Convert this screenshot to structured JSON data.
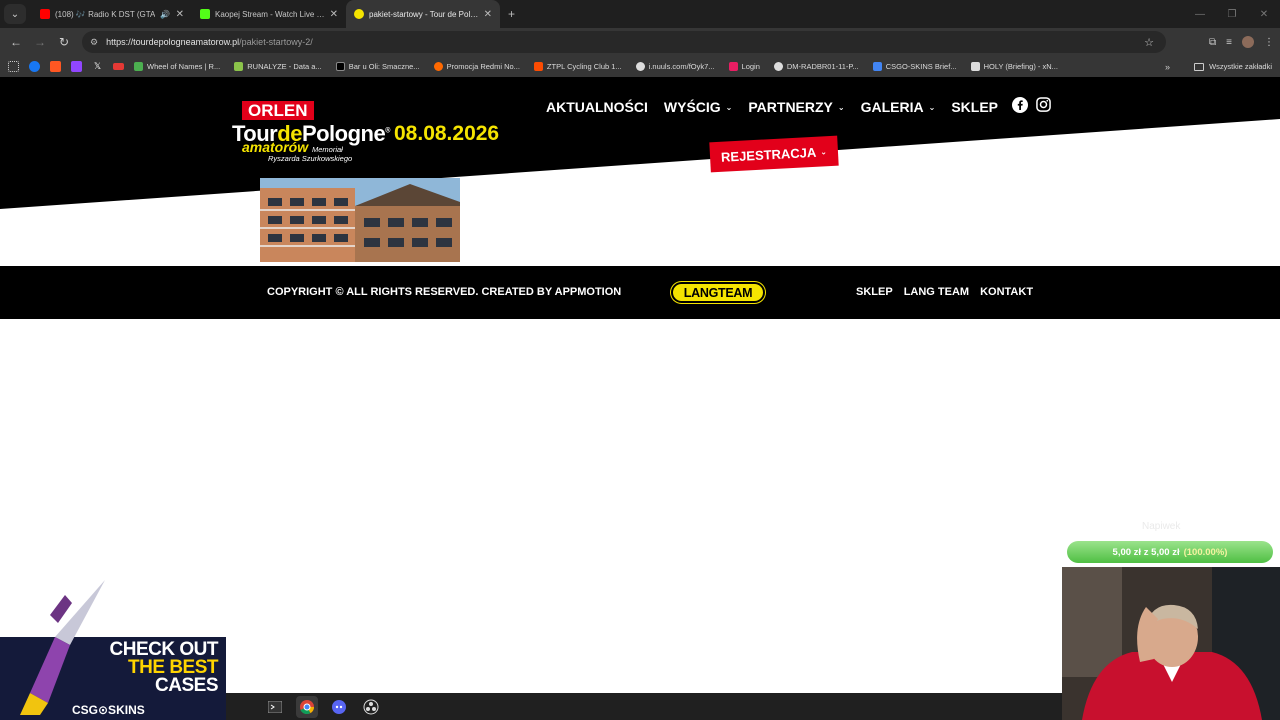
{
  "browser": {
    "tabs": [
      {
        "title": "(108) 🎶 Radio K DST (GTA",
        "favicon_color": "#ff0000",
        "active": false
      },
      {
        "title": "Kaopej Stream - Watch Live on",
        "favicon_color": "#53fc18",
        "active": false
      },
      {
        "title": "pakiet-startowy - Tour de Polog",
        "favicon_color": "#f5e400",
        "active": true
      }
    ],
    "url_domain": "https://tourdepologneamatorow.pl",
    "url_path": "/pakiet-startowy-2/",
    "bookmarks": [
      {
        "label": "Wheel of Names | R...",
        "color": "#4caf50"
      },
      {
        "label": "RUNALYZE - Data a...",
        "color": "#8bc34a"
      },
      {
        "label": "Bar u Oli: Smaczne...",
        "color": "#000000"
      },
      {
        "label": "Promocja Redmi No...",
        "color": "#ff6900"
      },
      {
        "label": "ZTPL Cycling Club 1...",
        "color": "#fc4c02"
      },
      {
        "label": "i.nuuls.com/fOyk7...",
        "color": "#dddddd"
      },
      {
        "label": "Login",
        "color": "#e91e63"
      },
      {
        "label": "DM-RADBR01-11-P...",
        "color": "#dddddd"
      },
      {
        "label": "CSGO-SKINS Brief...",
        "color": "#4285f4"
      },
      {
        "label": "HOLY (Briefing) - xN...",
        "color": "#dddddd"
      }
    ],
    "all_bookmarks": "Wszystkie zakładki"
  },
  "site": {
    "logo": {
      "orlen": "ORLEN",
      "tour": "Tour",
      "de": "de",
      "pologne": "Pologne",
      "registered": "®",
      "date": "08.08.2026",
      "amatorow": "amatorów",
      "memorial": "Memoriał",
      "ryszarda": "Ryszarda Szurkowskiego"
    },
    "nav": [
      {
        "label": "AKTUALNOŚCI",
        "dropdown": false
      },
      {
        "label": "WYŚCIG",
        "dropdown": true
      },
      {
        "label": "PARTNERZY",
        "dropdown": true
      },
      {
        "label": "GALERIA",
        "dropdown": true
      },
      {
        "label": "SKLEP",
        "dropdown": false
      }
    ],
    "register_label": "REJESTRACJA",
    "footer": {
      "copyright": "COPYRIGHT © ALL RIGHTS RESERVED. CREATED BY APPMOTION",
      "langteam": "LANGTEAM",
      "links": [
        "SKLEP",
        "LANG TEAM",
        "KONTAKT"
      ]
    },
    "colors": {
      "red": "#e2001a",
      "yellow": "#f5e400",
      "black": "#000000"
    }
  },
  "stream": {
    "tip_label": "Napiwek",
    "tip_amount": "5,00 zł z 5,00 zł",
    "tip_percent": "(100.00%)",
    "tip_progress": 1.0,
    "promo_line1": "CHECK OUT",
    "promo_line2": "THE BEST",
    "promo_line3": "CASES",
    "promo_brand": "CSG⊙SKINS"
  }
}
